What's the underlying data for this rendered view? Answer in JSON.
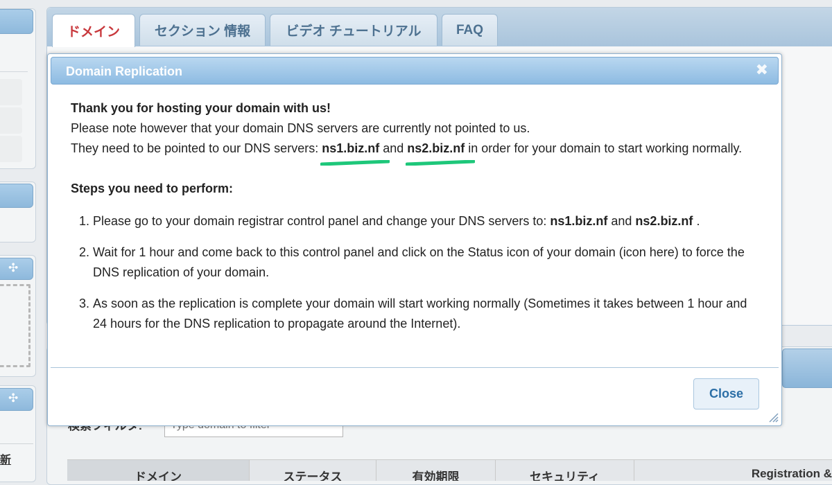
{
  "tabs": [
    {
      "label": "ドメイン",
      "active": true
    },
    {
      "label": "セクション 情報",
      "active": false
    },
    {
      "label": "ビデオ チュートリアル",
      "active": false
    },
    {
      "label": "FAQ",
      "active": false
    }
  ],
  "dialog": {
    "title": "Domain Replication",
    "heading": "Thank you for hosting your domain with us!",
    "note": "Please note however that your domain DNS servers are currently not pointed to us.",
    "pointed_prefix": "They need to be pointed to our DNS servers: ",
    "and_word": " and ",
    "pointed_suffix": " in order for your domain to start working normally.",
    "ns1": "ns1.biz.nf",
    "ns2": "ns2.biz.nf",
    "steps_title": "Steps you need to perform:",
    "step1_prefix": "Please go to your domain registrar control panel and change your DNS servers to: ",
    "step1_suffix": " .",
    "step2": "Wait for 1 hour and come back to this control panel and click on the Status icon of your domain (icon here) to force the DNS replication of your domain.",
    "step3": "As soon as the replication is complete your domain will start working normally (Sometimes it takes between 1 hour and 24 hours for the DNS replication to propagate around the Internet).",
    "close_label": "Close",
    "highlight_color": "#1ec77a"
  },
  "sidebar": {
    "refresh_label": "新"
  },
  "filter": {
    "label": "検索フィルタ:",
    "placeholder": "Type domain to filter"
  },
  "table": {
    "headers": [
      "ドメイン",
      "ステータス",
      "有効期限",
      "セキュリティ",
      "Registration &"
    ]
  }
}
